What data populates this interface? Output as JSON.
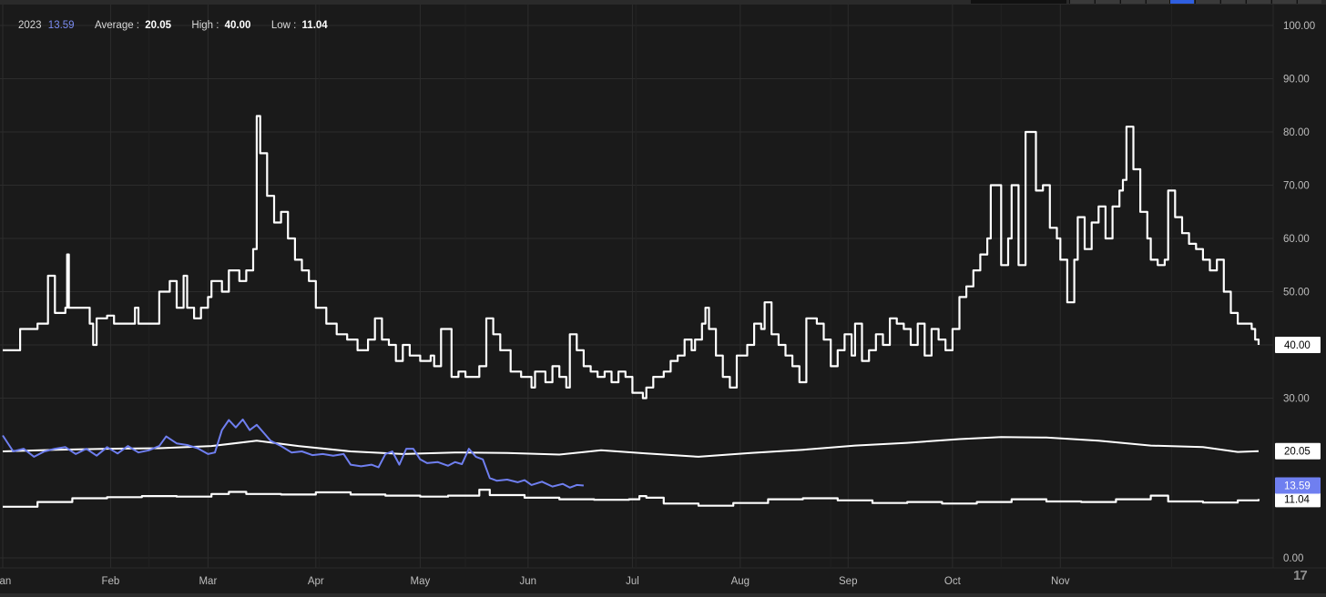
{
  "legend": {
    "year_label": "2023",
    "year_value": "13.59",
    "average_label": "Average :",
    "average_value": "20.05",
    "high_label": "High :",
    "high_value": "40.00",
    "low_label": "Low :",
    "low_value": "11.04"
  },
  "colors": {
    "background": "#1a1a1a",
    "grid": "#2c2c2c",
    "main_line": "#ffffff",
    "current_year_line": "#6f7ff0",
    "axis_text": "#bdbdbd"
  },
  "chart_data": {
    "type": "line",
    "ylim": [
      0,
      100
    ],
    "y_ticks": [
      "100.00",
      "90.00",
      "80.00",
      "70.00",
      "60.00",
      "50.00",
      "40.00",
      "30.00",
      "0.00"
    ],
    "x_ticks": [
      "Jan",
      "Feb",
      "Mar",
      "Apr",
      "May",
      "Jun",
      "Jul",
      "Aug",
      "Sep",
      "Oct",
      "Nov"
    ],
    "x_tick_days": [
      0,
      31,
      59,
      90,
      120,
      151,
      181,
      212,
      243,
      273,
      304
    ],
    "grid": true,
    "series": [
      {
        "label_value": "40.00",
        "style": "step",
        "color": "#ffffff",
        "points": [
          [
            0,
            39
          ],
          [
            5,
            43
          ],
          [
            10,
            44
          ],
          [
            13,
            53
          ],
          [
            15,
            46
          ],
          [
            18,
            47
          ],
          [
            18.5,
            57
          ],
          [
            19,
            47
          ],
          [
            25,
            44
          ],
          [
            26,
            40
          ],
          [
            27,
            45
          ],
          [
            30,
            45.5
          ],
          [
            32,
            44
          ],
          [
            35,
            44
          ],
          [
            38,
            47
          ],
          [
            39,
            44
          ],
          [
            42,
            44
          ],
          [
            45,
            50
          ],
          [
            48,
            52
          ],
          [
            50,
            47
          ],
          [
            52,
            53
          ],
          [
            53,
            47
          ],
          [
            55,
            45
          ],
          [
            57,
            47
          ],
          [
            59,
            49
          ],
          [
            60,
            52
          ],
          [
            63,
            50
          ],
          [
            65,
            54
          ],
          [
            68,
            52
          ],
          [
            70,
            54
          ],
          [
            72,
            58
          ],
          [
            73,
            83
          ],
          [
            74,
            76
          ],
          [
            76,
            68
          ],
          [
            78,
            63
          ],
          [
            80,
            65
          ],
          [
            82,
            60
          ],
          [
            84,
            56
          ],
          [
            86,
            54
          ],
          [
            88,
            52
          ],
          [
            90,
            47
          ],
          [
            93,
            44
          ],
          [
            96,
            42
          ],
          [
            99,
            41
          ],
          [
            102,
            39
          ],
          [
            105,
            41
          ],
          [
            107,
            45
          ],
          [
            109,
            41
          ],
          [
            111,
            40
          ],
          [
            113,
            37
          ],
          [
            115,
            40
          ],
          [
            117,
            38
          ],
          [
            120,
            37
          ],
          [
            123,
            38
          ],
          [
            124,
            36
          ],
          [
            126,
            43
          ],
          [
            129,
            34
          ],
          [
            131,
            35
          ],
          [
            133,
            34
          ],
          [
            135,
            34
          ],
          [
            137,
            36
          ],
          [
            139,
            45
          ],
          [
            141,
            42
          ],
          [
            143,
            39
          ],
          [
            146,
            35
          ],
          [
            149,
            34
          ],
          [
            152,
            32
          ],
          [
            153,
            35
          ],
          [
            156,
            33
          ],
          [
            158,
            36
          ],
          [
            160,
            34
          ],
          [
            162,
            32
          ],
          [
            163,
            42
          ],
          [
            165,
            39
          ],
          [
            167,
            36
          ],
          [
            169,
            35
          ],
          [
            171,
            34
          ],
          [
            173,
            35
          ],
          [
            175,
            33
          ],
          [
            177,
            35
          ],
          [
            179,
            34
          ],
          [
            181,
            31
          ],
          [
            184,
            30
          ],
          [
            185,
            32
          ],
          [
            187,
            34
          ],
          [
            190,
            35
          ],
          [
            192,
            37
          ],
          [
            194,
            38
          ],
          [
            196,
            41
          ],
          [
            198,
            39
          ],
          [
            199,
            41
          ],
          [
            201,
            44
          ],
          [
            202,
            47
          ],
          [
            203,
            43
          ],
          [
            205,
            38
          ],
          [
            207,
            34
          ],
          [
            209,
            32
          ],
          [
            211,
            38
          ],
          [
            214,
            40
          ],
          [
            216,
            44
          ],
          [
            218,
            43
          ],
          [
            219,
            48
          ],
          [
            221,
            42
          ],
          [
            223,
            40
          ],
          [
            225,
            38
          ],
          [
            227,
            36
          ],
          [
            229,
            33
          ],
          [
            231,
            45
          ],
          [
            234,
            44
          ],
          [
            236,
            41
          ],
          [
            238,
            36
          ],
          [
            240,
            39
          ],
          [
            242,
            42
          ],
          [
            244,
            38
          ],
          [
            245,
            44
          ],
          [
            247,
            37
          ],
          [
            249,
            39
          ],
          [
            251,
            42
          ],
          [
            253,
            40
          ],
          [
            255,
            45
          ],
          [
            257,
            44
          ],
          [
            259,
            43
          ],
          [
            261,
            40
          ],
          [
            263,
            44
          ],
          [
            265,
            38
          ],
          [
            267,
            43
          ],
          [
            269,
            41
          ],
          [
            271,
            39
          ],
          [
            273,
            43
          ],
          [
            275,
            49
          ],
          [
            277,
            51
          ],
          [
            279,
            54
          ],
          [
            281,
            57
          ],
          [
            283,
            60
          ],
          [
            284,
            70
          ],
          [
            287,
            55
          ],
          [
            289,
            60
          ],
          [
            290,
            70
          ],
          [
            292,
            55
          ],
          [
            294,
            80
          ],
          [
            297,
            69
          ],
          [
            299,
            70
          ],
          [
            301,
            62
          ],
          [
            303,
            60
          ],
          [
            304,
            56
          ],
          [
            306,
            48
          ],
          [
            308,
            56
          ],
          [
            309,
            64
          ],
          [
            311,
            58
          ],
          [
            313,
            63
          ],
          [
            315,
            66
          ],
          [
            317,
            60
          ],
          [
            319,
            66
          ],
          [
            321,
            69
          ],
          [
            322,
            71
          ],
          [
            323,
            81
          ],
          [
            325,
            73
          ],
          [
            327,
            65
          ],
          [
            329,
            60
          ],
          [
            330,
            56
          ],
          [
            332,
            55
          ],
          [
            334,
            56
          ],
          [
            335,
            69
          ],
          [
            337,
            64
          ],
          [
            339,
            61
          ],
          [
            341,
            59
          ],
          [
            343,
            58
          ],
          [
            345,
            56
          ],
          [
            347,
            54
          ],
          [
            349,
            56
          ],
          [
            351,
            50
          ],
          [
            353,
            46
          ],
          [
            355,
            44
          ],
          [
            357,
            44
          ],
          [
            359,
            43
          ],
          [
            360,
            41
          ],
          [
            361,
            40
          ]
        ]
      },
      {
        "label_value": "20.05",
        "style": "line",
        "color": "#ffffff",
        "points": [
          [
            0,
            20
          ],
          [
            15,
            20.3
          ],
          [
            30,
            20.5
          ],
          [
            45,
            20.6
          ],
          [
            60,
            21
          ],
          [
            73,
            22
          ],
          [
            85,
            21
          ],
          [
            100,
            20
          ],
          [
            115,
            19.5
          ],
          [
            130,
            19.8
          ],
          [
            145,
            19.7
          ],
          [
            160,
            19.4
          ],
          [
            172,
            20.2
          ],
          [
            185,
            19.6
          ],
          [
            200,
            19
          ],
          [
            215,
            19.7
          ],
          [
            230,
            20.3
          ],
          [
            245,
            21.1
          ],
          [
            260,
            21.6
          ],
          [
            275,
            22.3
          ],
          [
            287,
            22.7
          ],
          [
            300,
            22.6
          ],
          [
            315,
            22
          ],
          [
            330,
            21.1
          ],
          [
            345,
            20.8
          ],
          [
            355,
            19.9
          ],
          [
            361,
            20.05
          ]
        ]
      },
      {
        "label_value": "11.04",
        "style": "step",
        "color": "#ffffff",
        "points": [
          [
            0,
            9.6
          ],
          [
            10,
            10.5
          ],
          [
            20,
            11.2
          ],
          [
            30,
            11.4
          ],
          [
            40,
            11.6
          ],
          [
            50,
            11.5
          ],
          [
            60,
            12
          ],
          [
            65,
            12.4
          ],
          [
            70,
            12
          ],
          [
            80,
            11.9
          ],
          [
            90,
            12.3
          ],
          [
            100,
            11.9
          ],
          [
            110,
            11.7
          ],
          [
            120,
            11.5
          ],
          [
            128,
            11.7
          ],
          [
            137,
            12.8
          ],
          [
            140,
            11.8
          ],
          [
            150,
            11.3
          ],
          [
            160,
            11
          ],
          [
            170,
            10.9
          ],
          [
            180,
            11
          ],
          [
            183,
            11.6
          ],
          [
            185,
            11.3
          ],
          [
            190,
            10.2
          ],
          [
            200,
            9.8
          ],
          [
            210,
            10.3
          ],
          [
            220,
            11
          ],
          [
            230,
            11.2
          ],
          [
            240,
            10.8
          ],
          [
            250,
            10.3
          ],
          [
            260,
            10.5
          ],
          [
            270,
            10.2
          ],
          [
            280,
            10.5
          ],
          [
            290,
            11
          ],
          [
            300,
            10.6
          ],
          [
            310,
            10.5
          ],
          [
            320,
            11
          ],
          [
            330,
            11.7
          ],
          [
            335,
            10.6
          ],
          [
            345,
            10.4
          ],
          [
            355,
            10.8
          ],
          [
            361,
            11.04
          ]
        ]
      },
      {
        "name": "2023",
        "label_value": "13.59",
        "style": "line",
        "color": "#6f7ff0",
        "points": [
          [
            0,
            23
          ],
          [
            3,
            20
          ],
          [
            6,
            20.5
          ],
          [
            9,
            19
          ],
          [
            12,
            20
          ],
          [
            15,
            20.5
          ],
          [
            18,
            20.8
          ],
          [
            21,
            19.5
          ],
          [
            24,
            20.5
          ],
          [
            27,
            19.2
          ],
          [
            30,
            20.8
          ],
          [
            33,
            19.6
          ],
          [
            36,
            21
          ],
          [
            39,
            19.8
          ],
          [
            42,
            20.2
          ],
          [
            45,
            21
          ],
          [
            47,
            22.8
          ],
          [
            50,
            21.5
          ],
          [
            53,
            21.2
          ],
          [
            56,
            20.6
          ],
          [
            59,
            19.5
          ],
          [
            61,
            19.8
          ],
          [
            63,
            24
          ],
          [
            65,
            25.9
          ],
          [
            67,
            24.5
          ],
          [
            69,
            26
          ],
          [
            71,
            24
          ],
          [
            73,
            25
          ],
          [
            75,
            23.5
          ],
          [
            77,
            22
          ],
          [
            80,
            21
          ],
          [
            83,
            19.8
          ],
          [
            86,
            20
          ],
          [
            89,
            19.3
          ],
          [
            92,
            19.5
          ],
          [
            95,
            19.2
          ],
          [
            98,
            19.5
          ],
          [
            100,
            17.5
          ],
          [
            103,
            17.2
          ],
          [
            106,
            17.5
          ],
          [
            108,
            17
          ],
          [
            110,
            19.5
          ],
          [
            112,
            20
          ],
          [
            114,
            17.5
          ],
          [
            116,
            20.5
          ],
          [
            118,
            20.5
          ],
          [
            120,
            18.5
          ],
          [
            122,
            17.8
          ],
          [
            125,
            18
          ],
          [
            128,
            17.3
          ],
          [
            130,
            18
          ],
          [
            132,
            17.6
          ],
          [
            134,
            20.5
          ],
          [
            136,
            19
          ],
          [
            138,
            18.5
          ],
          [
            140,
            15
          ],
          [
            142,
            14.5
          ],
          [
            145,
            14.7
          ],
          [
            148,
            14.2
          ],
          [
            150,
            14.6
          ],
          [
            152,
            13.7
          ],
          [
            155,
            14.3
          ],
          [
            158,
            13.4
          ],
          [
            161,
            13.9
          ],
          [
            163,
            13.2
          ],
          [
            165,
            13.7
          ],
          [
            167,
            13.59
          ]
        ]
      }
    ]
  }
}
